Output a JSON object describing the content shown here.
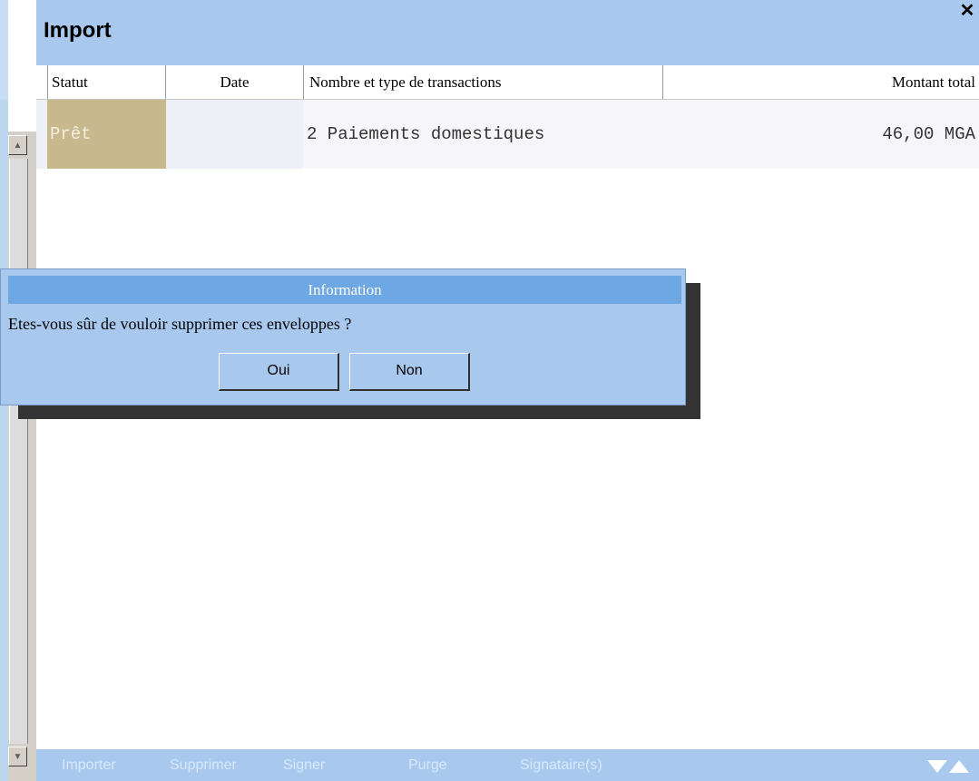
{
  "window": {
    "title": "Import",
    "close_icon": "close-icon"
  },
  "table": {
    "headers": [
      "Statut",
      "Date",
      "Nombre et type de transactions",
      "Montant total"
    ],
    "rows": [
      {
        "status": "Prêt",
        "date": "",
        "transactions": "2 Paiements domestiques",
        "amount": "46,00 MGA"
      }
    ]
  },
  "dialog": {
    "title": "Information",
    "message": "Etes-vous sûr de vouloir supprimer ces enveloppes ?",
    "yes_label": "Oui",
    "no_label": "Non"
  },
  "toolbar": {
    "items": [
      "Importer",
      "Supprimer",
      "Signer",
      "Purge",
      "Signataire(s)"
    ]
  },
  "colors": {
    "title_bar": "#a8c8ee",
    "dialog_title": "#6ea8e4",
    "status_ready": "#c8b88e"
  }
}
